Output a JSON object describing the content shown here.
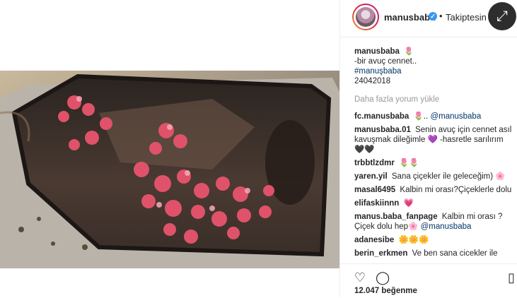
{
  "header": {
    "username": "manusbaba",
    "verified_icon": "verified-check-icon",
    "separator": "•",
    "follow_label": "Takiptesin",
    "expand_icon": "expand-arrows-icon"
  },
  "caption": {
    "username": "manusbaba",
    "emoji": "🌷",
    "line1": "-bir avuç cennet..",
    "hashtag": "#manuşbaba",
    "date": "24042018"
  },
  "load_more": "Daha fazla yorum yükle",
  "comments": [
    {
      "user": "fc.manusbaba",
      "text_parts": [
        "🌷..",
        "@manusbaba"
      ]
    },
    {
      "user": "manusbaba.01",
      "text_parts": [
        "Senin avuç için cennet asıl kavuşmak dileğimle",
        "💜 -hasretle sarılırım 🖤🖤"
      ]
    },
    {
      "user": "trbbtlzdmr",
      "text_parts": [
        "🌷🌷"
      ]
    },
    {
      "user": "yaren.yil",
      "text_parts": [
        "Sana çiçekler ile geleceğim)",
        "🌸"
      ]
    },
    {
      "user": "masal6495",
      "text_parts": [
        "Kalbin mi orası?Çiçeklerle dolu"
      ]
    },
    {
      "user": "elifaskiinnn",
      "text_parts": [
        "💗"
      ]
    },
    {
      "user": "manus.baba_fanpage",
      "text_parts": [
        "Kalbin mi orası ? Çiçek dolu hep🌸",
        "@manusbaba"
      ]
    },
    {
      "user": "adanesibe",
      "text_parts": [
        "🌼🌼🌼"
      ]
    },
    {
      "user": "berin_erkmen",
      "text_parts": [
        "Ve ben sana cicekler ile"
      ]
    }
  ],
  "actions": {
    "heart_icon": "heart-icon",
    "comment_icon": "comment-icon",
    "bookmark_icon": "bookmark-icon"
  },
  "likes": "12.047 beğenme",
  "colors": {
    "verified": "#3897f0",
    "link": "#003569",
    "muted": "#999999"
  }
}
